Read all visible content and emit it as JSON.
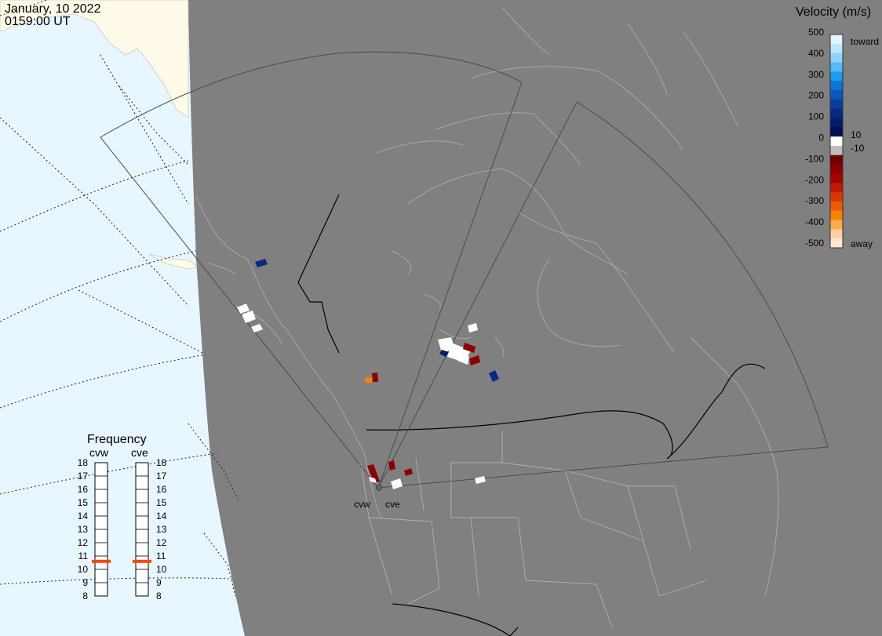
{
  "header": {
    "date": "January, 10 2022",
    "time": "0159:00 UT"
  },
  "colors": {
    "ocean": "#e8f6ff",
    "land_sunlit": "#fffbe8",
    "night": "#808080",
    "coast": "#a8a8a8",
    "fov": "#555555",
    "border": "#000000"
  },
  "legend": {
    "title": "Velocity (m/s)",
    "ticks": [
      "500",
      "400",
      "300",
      "200",
      "100",
      "0",
      "-100",
      "-200",
      "-300",
      "-400",
      "-500"
    ],
    "label_toward": "toward",
    "label_away": "away",
    "label_pos_threshold": "10",
    "label_neg_threshold": "-10",
    "colors_top_to_bottom": [
      "#e4f4ff",
      "#bfe6ff",
      "#90d2ff",
      "#56b8ff",
      "#1e9aef",
      "#0d74d8",
      "#0a56bc",
      "#0a3d9e",
      "#082a84",
      "#051c6a",
      "#020f52",
      "#ffffff",
      "#bdbdbd",
      "#6e0000",
      "#8c0000",
      "#a80000",
      "#c21a00",
      "#d93600",
      "#ee5a00",
      "#fb8100",
      "#ffab4a",
      "#ffd1a0",
      "#ffe8d0"
    ]
  },
  "radars": [
    {
      "code": "cvw",
      "name_label": "cvw"
    },
    {
      "code": "cve",
      "name_label": "cve"
    }
  ],
  "frequency_panel": {
    "title": "Frequency",
    "columns": [
      {
        "label": "cvw",
        "current_mhz": 10.6
      },
      {
        "label": "cve",
        "current_mhz": 10.6
      }
    ],
    "ticks": [
      "18",
      "17",
      "16",
      "15",
      "14",
      "13",
      "12",
      "11",
      "10",
      "9",
      "8"
    ],
    "indicator_color": "#ff4500"
  },
  "velocity_cells": [
    {
      "region": "yukon",
      "value": 150
    },
    {
      "region": "bc-coast-1",
      "value": 0
    },
    {
      "region": "bc-coast-2",
      "value": 0
    },
    {
      "region": "bc-coast-3",
      "value": 0
    },
    {
      "region": "alberta-1",
      "value": -150
    },
    {
      "region": "alberta-2",
      "value": -350
    },
    {
      "region": "sask-1",
      "value": 0
    },
    {
      "region": "sask-2",
      "value": 0
    },
    {
      "region": "sask-3",
      "value": -150
    },
    {
      "region": "sask-4",
      "value": 100
    },
    {
      "region": "manitoba",
      "value": 120
    },
    {
      "region": "dakota",
      "value": 0
    },
    {
      "region": "near-radar-1",
      "value": -150
    },
    {
      "region": "near-radar-2",
      "value": -120
    },
    {
      "region": "near-radar-3",
      "value": 0
    }
  ]
}
